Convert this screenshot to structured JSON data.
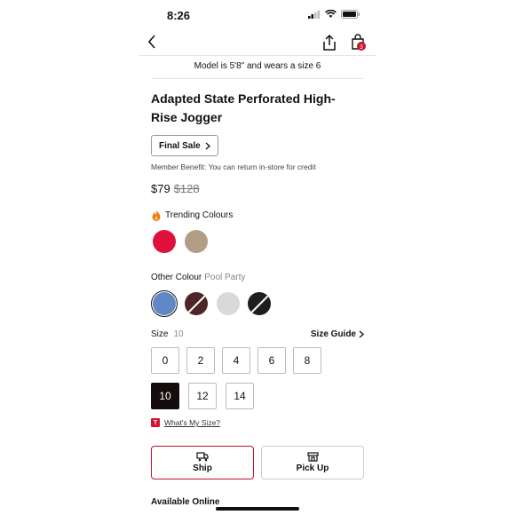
{
  "status_bar": {
    "time": "8:26"
  },
  "nav": {
    "back_icon": "chevron-left-icon",
    "share_icon": "share-icon",
    "bag_icon": "shopping-bag-icon",
    "bag_count": "3"
  },
  "model_note": "Model is 5'8\" and wears a size 6",
  "product": {
    "title": "Adapted State Perforated High-Rise Jogger",
    "final_sale_label": "Final Sale",
    "member_benefit": "Member Benefit: You can return in-store for credit",
    "price": "$79",
    "original_price": "$128"
  },
  "trending": {
    "label": "Trending Colours",
    "swatches": [
      {
        "color": "#e0103c"
      },
      {
        "color": "#b29e85"
      }
    ]
  },
  "other_colours": {
    "label": "Other Colour",
    "selected_name": "Pool Party",
    "swatches": [
      {
        "color": "#5f88c4",
        "selected": true,
        "unavailable": false
      },
      {
        "color": "#4e2528",
        "selected": false,
        "unavailable": true
      },
      {
        "color": "#d9d9db",
        "selected": false,
        "unavailable": false
      },
      {
        "color": "#1e1e1e",
        "selected": false,
        "unavailable": true
      }
    ]
  },
  "size": {
    "label": "Size",
    "selected": "10",
    "guide_label": "Size Guide",
    "options": [
      "0",
      "2",
      "4",
      "6",
      "8",
      "10",
      "12",
      "14"
    ],
    "whats_my_size_label": "What's My Size?",
    "badge_letter": "T"
  },
  "fulfillment": {
    "ship_label": "Ship",
    "pickup_label": "Pick Up"
  },
  "availability_label": "Available Online",
  "colors": {
    "accent": "#c8102e",
    "selected_size_bg": "#150d0d"
  }
}
